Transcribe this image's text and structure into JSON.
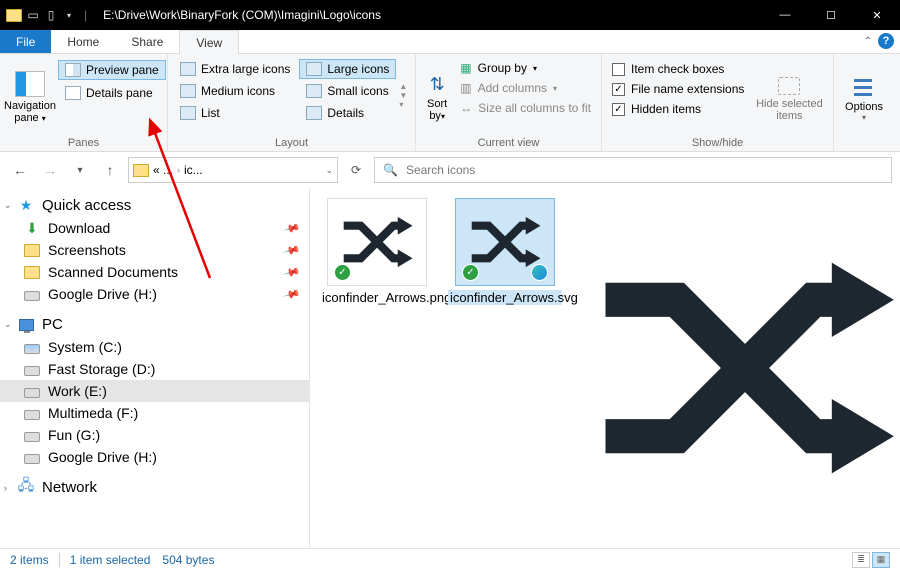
{
  "title": "E:\\Drive\\Work\\BinaryFork (COM)\\Imagini\\Logo\\icons",
  "menu": {
    "file": "File",
    "home": "Home",
    "share": "Share",
    "view": "View"
  },
  "ribbon": {
    "panes": {
      "label": "Panes",
      "navigation": "Navigation pane",
      "preview": "Preview pane",
      "details": "Details pane"
    },
    "layout": {
      "label": "Layout",
      "extra_large": "Extra large icons",
      "large": "Large icons",
      "medium": "Medium icons",
      "small": "Small icons",
      "list": "List",
      "details": "Details"
    },
    "current": {
      "label": "Current view",
      "sort": "Sort by",
      "group": "Group by",
      "add_cols": "Add columns",
      "size_cols": "Size all columns to fit"
    },
    "showhide": {
      "label": "Show/hide",
      "item_check": "Item check boxes",
      "file_ext": "File name extensions",
      "hidden": "Hidden items",
      "hide_sel": "Hide selected items"
    },
    "options": "Options"
  },
  "breadcrumb": {
    "ellipsis": "« ...",
    "current": "ic..."
  },
  "search_placeholder": "Search icons",
  "nav": {
    "quick": "Quick access",
    "quick_items": [
      {
        "label": "Download",
        "pinned": true,
        "icon": "download"
      },
      {
        "label": "Screenshots",
        "pinned": true,
        "icon": "folder"
      },
      {
        "label": "Scanned Documents",
        "pinned": true,
        "icon": "folder"
      },
      {
        "label": "Google Drive (H:)",
        "pinned": true,
        "icon": "drive"
      }
    ],
    "pc": "PC",
    "pc_items": [
      {
        "label": "System (C:)",
        "icon": "sysdrive"
      },
      {
        "label": "Fast Storage (D:)",
        "icon": "drive"
      },
      {
        "label": "Work (E:)",
        "icon": "drive",
        "selected": true
      },
      {
        "label": "Multimeda (F:)",
        "icon": "drive"
      },
      {
        "label": "Fun (G:)",
        "icon": "drive"
      },
      {
        "label": "Google Drive (H:)",
        "icon": "drive"
      }
    ],
    "network": "Network"
  },
  "files": [
    {
      "name": "iconfinder_Arrows.png",
      "selected": false
    },
    {
      "name": "iconfinder_Arrows.svg",
      "selected": true
    }
  ],
  "status": {
    "items": "2 items",
    "selected": "1 item selected",
    "size": "504 bytes"
  }
}
